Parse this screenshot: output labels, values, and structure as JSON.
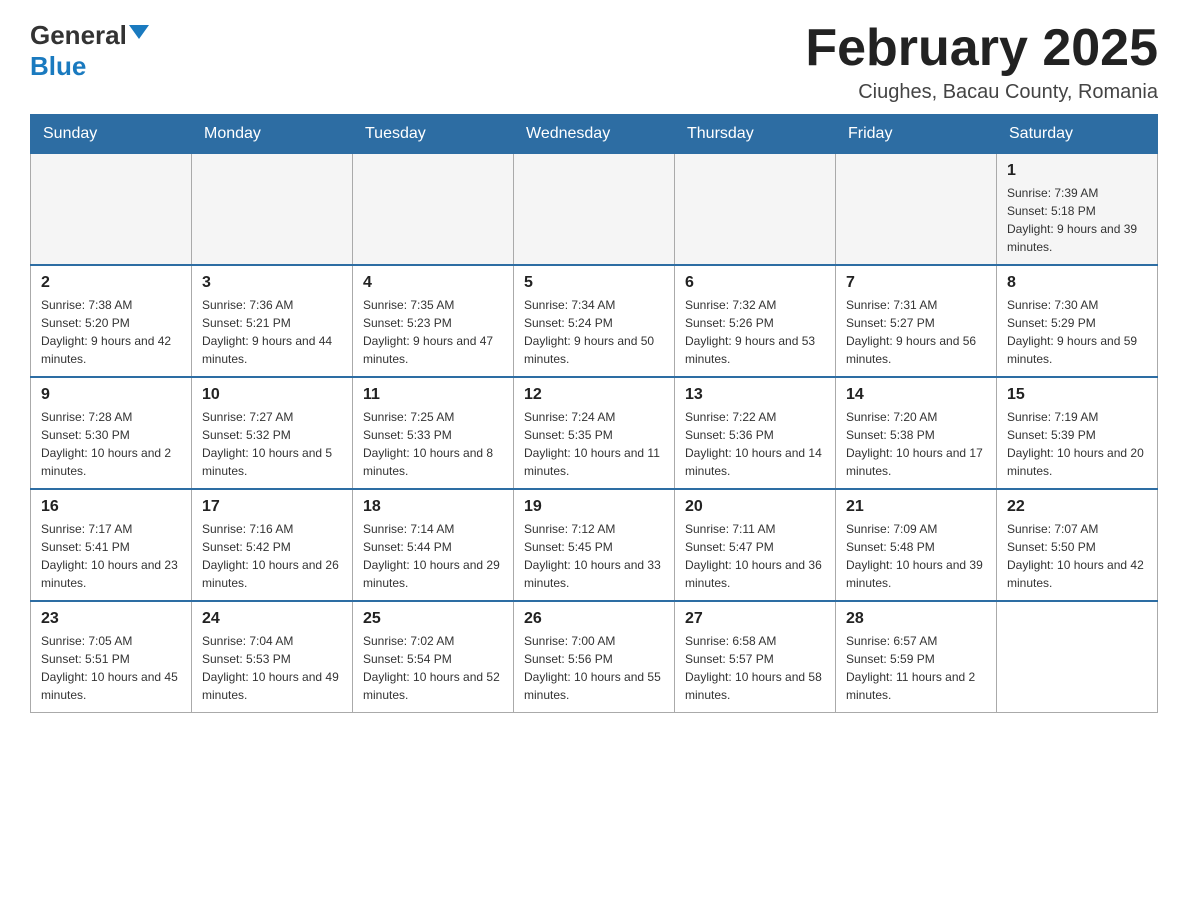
{
  "header": {
    "logo_general": "General",
    "logo_blue": "Blue",
    "month_title": "February 2025",
    "location": "Ciughes, Bacau County, Romania"
  },
  "days_of_week": [
    "Sunday",
    "Monday",
    "Tuesday",
    "Wednesday",
    "Thursday",
    "Friday",
    "Saturday"
  ],
  "weeks": [
    [
      {
        "day": "",
        "info": ""
      },
      {
        "day": "",
        "info": ""
      },
      {
        "day": "",
        "info": ""
      },
      {
        "day": "",
        "info": ""
      },
      {
        "day": "",
        "info": ""
      },
      {
        "day": "",
        "info": ""
      },
      {
        "day": "1",
        "info": "Sunrise: 7:39 AM\nSunset: 5:18 PM\nDaylight: 9 hours and 39 minutes."
      }
    ],
    [
      {
        "day": "2",
        "info": "Sunrise: 7:38 AM\nSunset: 5:20 PM\nDaylight: 9 hours and 42 minutes."
      },
      {
        "day": "3",
        "info": "Sunrise: 7:36 AM\nSunset: 5:21 PM\nDaylight: 9 hours and 44 minutes."
      },
      {
        "day": "4",
        "info": "Sunrise: 7:35 AM\nSunset: 5:23 PM\nDaylight: 9 hours and 47 minutes."
      },
      {
        "day": "5",
        "info": "Sunrise: 7:34 AM\nSunset: 5:24 PM\nDaylight: 9 hours and 50 minutes."
      },
      {
        "day": "6",
        "info": "Sunrise: 7:32 AM\nSunset: 5:26 PM\nDaylight: 9 hours and 53 minutes."
      },
      {
        "day": "7",
        "info": "Sunrise: 7:31 AM\nSunset: 5:27 PM\nDaylight: 9 hours and 56 minutes."
      },
      {
        "day": "8",
        "info": "Sunrise: 7:30 AM\nSunset: 5:29 PM\nDaylight: 9 hours and 59 minutes."
      }
    ],
    [
      {
        "day": "9",
        "info": "Sunrise: 7:28 AM\nSunset: 5:30 PM\nDaylight: 10 hours and 2 minutes."
      },
      {
        "day": "10",
        "info": "Sunrise: 7:27 AM\nSunset: 5:32 PM\nDaylight: 10 hours and 5 minutes."
      },
      {
        "day": "11",
        "info": "Sunrise: 7:25 AM\nSunset: 5:33 PM\nDaylight: 10 hours and 8 minutes."
      },
      {
        "day": "12",
        "info": "Sunrise: 7:24 AM\nSunset: 5:35 PM\nDaylight: 10 hours and 11 minutes."
      },
      {
        "day": "13",
        "info": "Sunrise: 7:22 AM\nSunset: 5:36 PM\nDaylight: 10 hours and 14 minutes."
      },
      {
        "day": "14",
        "info": "Sunrise: 7:20 AM\nSunset: 5:38 PM\nDaylight: 10 hours and 17 minutes."
      },
      {
        "day": "15",
        "info": "Sunrise: 7:19 AM\nSunset: 5:39 PM\nDaylight: 10 hours and 20 minutes."
      }
    ],
    [
      {
        "day": "16",
        "info": "Sunrise: 7:17 AM\nSunset: 5:41 PM\nDaylight: 10 hours and 23 minutes."
      },
      {
        "day": "17",
        "info": "Sunrise: 7:16 AM\nSunset: 5:42 PM\nDaylight: 10 hours and 26 minutes."
      },
      {
        "day": "18",
        "info": "Sunrise: 7:14 AM\nSunset: 5:44 PM\nDaylight: 10 hours and 29 minutes."
      },
      {
        "day": "19",
        "info": "Sunrise: 7:12 AM\nSunset: 5:45 PM\nDaylight: 10 hours and 33 minutes."
      },
      {
        "day": "20",
        "info": "Sunrise: 7:11 AM\nSunset: 5:47 PM\nDaylight: 10 hours and 36 minutes."
      },
      {
        "day": "21",
        "info": "Sunrise: 7:09 AM\nSunset: 5:48 PM\nDaylight: 10 hours and 39 minutes."
      },
      {
        "day": "22",
        "info": "Sunrise: 7:07 AM\nSunset: 5:50 PM\nDaylight: 10 hours and 42 minutes."
      }
    ],
    [
      {
        "day": "23",
        "info": "Sunrise: 7:05 AM\nSunset: 5:51 PM\nDaylight: 10 hours and 45 minutes."
      },
      {
        "day": "24",
        "info": "Sunrise: 7:04 AM\nSunset: 5:53 PM\nDaylight: 10 hours and 49 minutes."
      },
      {
        "day": "25",
        "info": "Sunrise: 7:02 AM\nSunset: 5:54 PM\nDaylight: 10 hours and 52 minutes."
      },
      {
        "day": "26",
        "info": "Sunrise: 7:00 AM\nSunset: 5:56 PM\nDaylight: 10 hours and 55 minutes."
      },
      {
        "day": "27",
        "info": "Sunrise: 6:58 AM\nSunset: 5:57 PM\nDaylight: 10 hours and 58 minutes."
      },
      {
        "day": "28",
        "info": "Sunrise: 6:57 AM\nSunset: 5:59 PM\nDaylight: 11 hours and 2 minutes."
      },
      {
        "day": "",
        "info": ""
      }
    ]
  ]
}
